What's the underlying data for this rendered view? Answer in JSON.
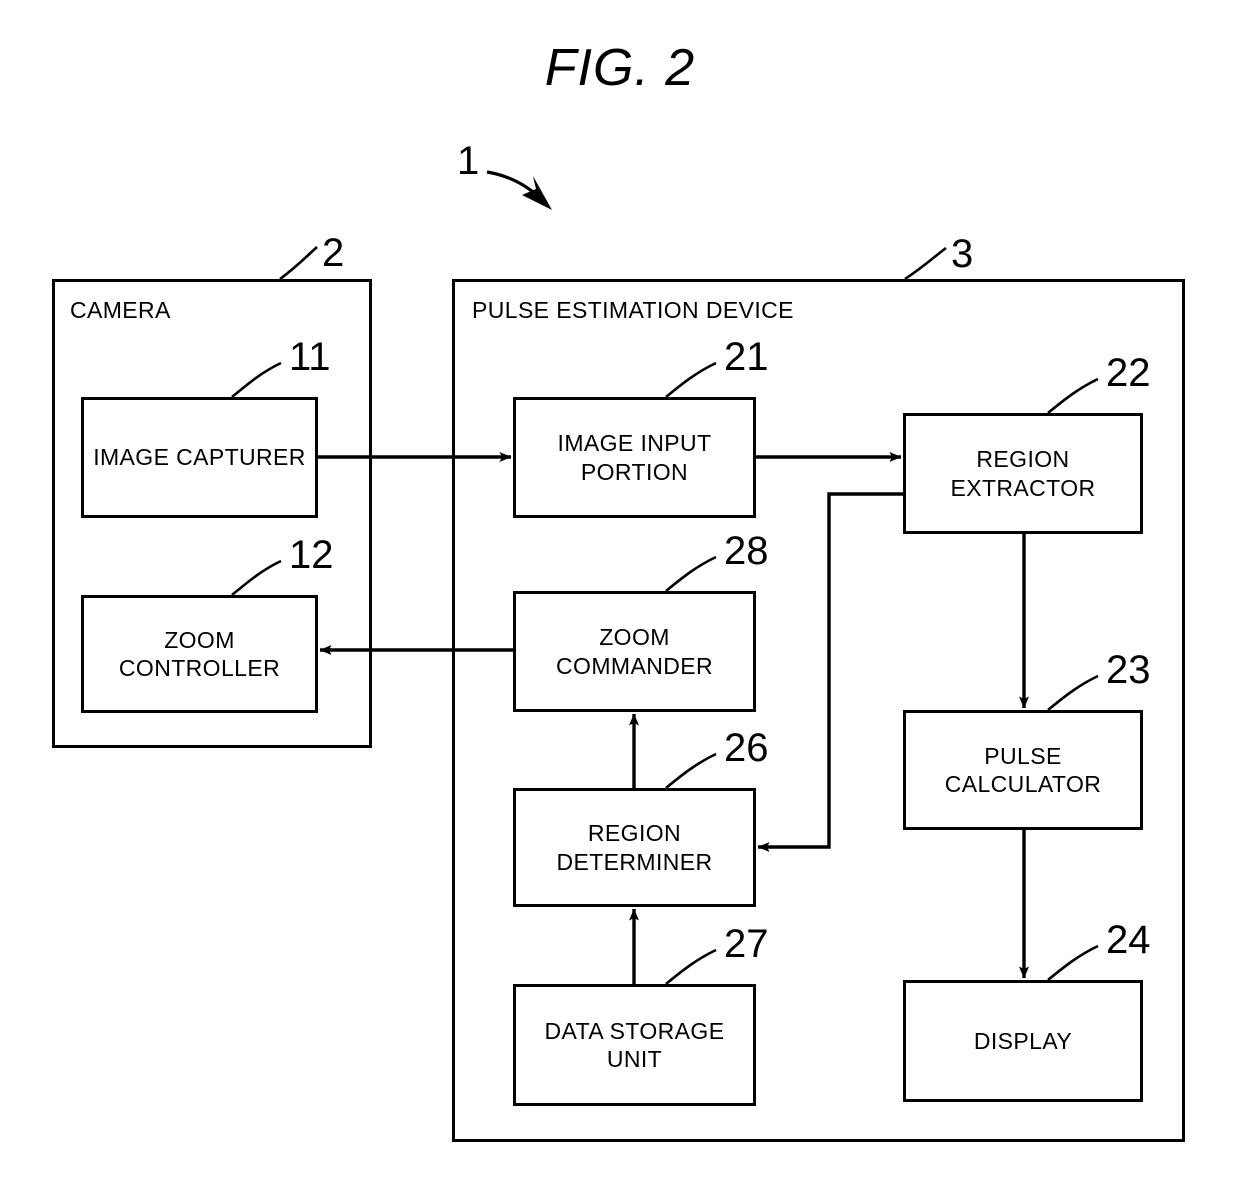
{
  "figure": {
    "title": "FIG. 2",
    "system_ref": "1"
  },
  "containers": [
    {
      "name": "camera",
      "label": "CAMERA",
      "ref": "2"
    },
    {
      "name": "pulse-estimation-device",
      "label": "PULSE ESTIMATION DEVICE",
      "ref": "3"
    }
  ],
  "blocks": [
    {
      "name": "image-capturer",
      "label": "IMAGE CAPTURER",
      "ref": "11"
    },
    {
      "name": "zoom-controller",
      "label": "ZOOM\nCONTROLLER",
      "ref": "12"
    },
    {
      "name": "image-input-portion",
      "label": "IMAGE INPUT\nPORTION",
      "ref": "21"
    },
    {
      "name": "region-extractor",
      "label": "REGION\nEXTRACTOR",
      "ref": "22"
    },
    {
      "name": "pulse-calculator",
      "label": "PULSE\nCALCULATOR",
      "ref": "23"
    },
    {
      "name": "display",
      "label": "DISPLAY",
      "ref": "24"
    },
    {
      "name": "region-determiner",
      "label": "REGION\nDETERMINER",
      "ref": "26"
    },
    {
      "name": "data-storage-unit",
      "label": "DATA STORAGE\nUNIT",
      "ref": "27"
    },
    {
      "name": "zoom-commander",
      "label": "ZOOM\nCOMMANDER",
      "ref": "28"
    }
  ],
  "labels": {
    "camera": "CAMERA",
    "pulse_estimation_device": "PULSE ESTIMATION DEVICE",
    "image_capturer": "IMAGE CAPTURER",
    "zoom_controller_line1": "ZOOM",
    "zoom_controller_line2": "CONTROLLER",
    "image_input_portion_line1": "IMAGE INPUT",
    "image_input_portion_line2": "PORTION",
    "region_extractor_line1": "REGION",
    "region_extractor_line2": "EXTRACTOR",
    "pulse_calculator_line1": "PULSE",
    "pulse_calculator_line2": "CALCULATOR",
    "display": "DISPLAY",
    "region_determiner_line1": "REGION",
    "region_determiner_line2": "DETERMINER",
    "data_storage_unit_line1": "DATA STORAGE",
    "data_storage_unit_line2": "UNIT",
    "zoom_commander_line1": "ZOOM",
    "zoom_commander_line2": "COMMANDER"
  },
  "refs": {
    "system": "1",
    "camera": "2",
    "device": "3",
    "image_capturer": "11",
    "zoom_controller": "12",
    "image_input_portion": "21",
    "region_extractor": "22",
    "pulse_calculator": "23",
    "display": "24",
    "region_determiner": "26",
    "data_storage_unit": "27",
    "zoom_commander": "28"
  },
  "connections": [
    {
      "name": "capturer-to-input",
      "from": "image-capturer",
      "to": "image-input-portion",
      "direction": "right"
    },
    {
      "name": "input-to-extractor",
      "from": "image-input-portion",
      "to": "region-extractor",
      "direction": "right"
    },
    {
      "name": "extractor-to-determiner",
      "from": "region-extractor",
      "to": "region-determiner",
      "direction": "left"
    },
    {
      "name": "extractor-to-calculator",
      "from": "region-extractor",
      "to": "pulse-calculator",
      "direction": "down"
    },
    {
      "name": "calculator-to-display",
      "from": "pulse-calculator",
      "to": "display",
      "direction": "down"
    },
    {
      "name": "storage-to-determiner",
      "from": "data-storage-unit",
      "to": "region-determiner",
      "direction": "up"
    },
    {
      "name": "determiner-to-commander",
      "from": "region-determiner",
      "to": "zoom-commander",
      "direction": "up"
    },
    {
      "name": "commander-to-zoomctrl",
      "from": "zoom-commander",
      "to": "zoom-controller",
      "direction": "left"
    }
  ],
  "style": {
    "ink": "#000000",
    "paper": "#ffffff"
  }
}
